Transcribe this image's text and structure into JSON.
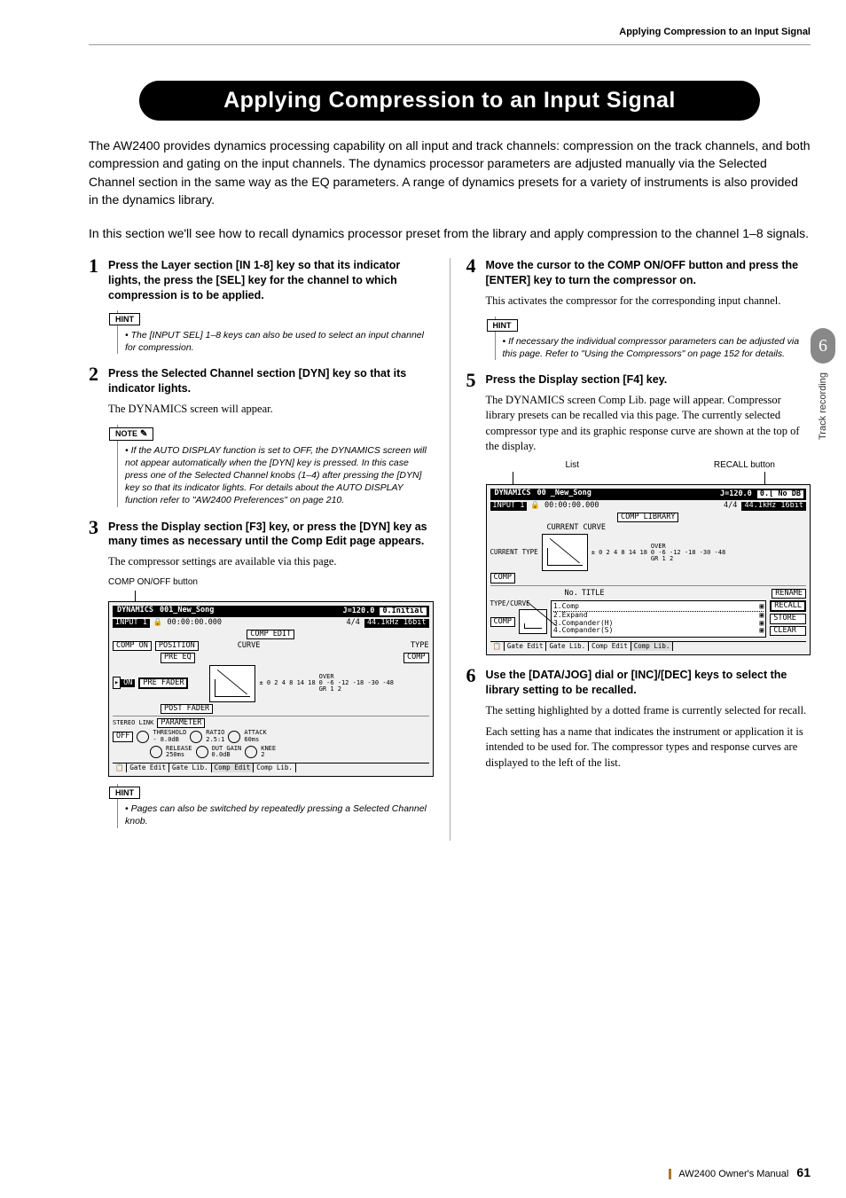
{
  "header": {
    "breadcrumb": "Applying Compression to an Input Signal"
  },
  "chapter": {
    "number": "6",
    "label": "Track recording"
  },
  "title": "Applying Compression to an Input Signal",
  "intro_p1": "The AW2400 provides dynamics processing capability on all input and track channels: compression on the track channels, and both compression and gating on the input channels. The dynamics processor parameters are adjusted manually via the Selected Channel section in the same way as the EQ parameters. A range of dynamics presets for a variety of instruments is also provided in the dynamics library.",
  "intro_p2": "In this section we'll see how to recall dynamics processor preset from the library and apply compression to the channel 1–8 signals.",
  "steps": {
    "s1": {
      "num": "1",
      "head": "Press the Layer section [IN 1-8] key so that its indicator lights, the press the [SEL] key for the channel to which compression is to be applied.",
      "hint": "The [INPUT SEL] 1–8 keys can also be used to select an input channel for compression."
    },
    "s2": {
      "num": "2",
      "head": "Press the Selected Channel section [DYN] key so that its indicator lights.",
      "body": "The DYNAMICS screen will appear.",
      "note": "If the AUTO DISPLAY function is set to OFF, the DYNAMICS screen will not appear automatically when the [DYN] key is pressed. In this case press one of the Selected Channel knobs (1–4) after pressing the [DYN] key so that its indicator lights. For details about the AUTO DISPLAY function refer to \"AW2400 Preferences\" on page 210."
    },
    "s3": {
      "num": "3",
      "head": "Press the Display section [F3] key, or press the [DYN] key as many times as necessary until the Comp Edit page appears.",
      "body": "The compressor settings are available via this page.",
      "caption": "COMP ON/OFF button",
      "hint": "Pages can also be switched by repeatedly pressing a Selected Channel knob."
    },
    "s4": {
      "num": "4",
      "head": "Move the cursor to the COMP ON/OFF button and press the [ENTER] key to turn the compressor on.",
      "body": "This activates the compressor for the corresponding input channel.",
      "hint": "If necessary the individual compressor parameters can be adjusted via this page. Refer to \"Using the Compressors\" on page 152 for details."
    },
    "s5": {
      "num": "5",
      "head": "Press the Display section [F4] key.",
      "body": "The DYNAMICS screen Comp Lib. page will appear. Compressor library presets can be recalled via this page. The currently selected compressor type and its graphic response curve are shown at the top of the display.",
      "label_list": "List",
      "label_recall": "RECALL button"
    },
    "s6": {
      "num": "6",
      "head": "Use the [DATA/JOG] dial or [INC]/[DEC] keys to select the library setting to be recalled.",
      "body1": "The setting highlighted by a dotted frame is currently selected for recall.",
      "body2": "Each setting has a name that indicates the instrument or application it is intended to be used for. The compressor types and response curves are displayed to the left of the list."
    }
  },
  "labels": {
    "hint": "HINT",
    "note": "NOTE"
  },
  "lcd1": {
    "title": "DYNAMICS",
    "sub": "INPUT 1",
    "song": "001_New_Song",
    "date": "00:00:00.000",
    "tempo": "J=120.0",
    "sig": "4/4",
    "preset": "0.Initial",
    "fmt": "44.1kHz 16bit",
    "section": "COMP EDIT",
    "comp_on": "COMP ON",
    "position": "POSITION",
    "pre_eq": "PRE EQ",
    "on": "ON",
    "pre_fader": "PRE FADER",
    "post_fader": "POST FADER",
    "curve": "CURVE",
    "type": "TYPE",
    "comp": "COMP",
    "stereo": "STEREO LINK",
    "off": "OFF",
    "parameter": "PARAMETER",
    "threshold": "THRESHOLD",
    "threshold_v": "- 8.0dB",
    "ratio": "RATIO",
    "ratio_v": "2.5:1",
    "attack": "ATTACK",
    "attack_v": "60ms",
    "release": "RELEASE",
    "release_v": "250ms",
    "outgain": "OUT GAIN",
    "outgain_v": "0.0dB",
    "knee": "KNEE",
    "knee_v": "2",
    "tabs": [
      "Gate Edit",
      "Gate Lib.",
      "Comp Edit",
      "Comp Lib."
    ],
    "meter_vals": "0 -6 -12 -18 -30 -48",
    "gr_vals": "0 2 4 8 14 18",
    "over": "OVER",
    "gr": "GR 1 2"
  },
  "lcd2": {
    "title": "DYNAMICS",
    "sub": "INPUT 1",
    "song": "00 _New_Song",
    "date": "00:00:00.000",
    "tempo": "J=120.0",
    "sig": "4/4",
    "nodb": "No DB",
    "fmt": "44.1kHz 16bit",
    "section": "COMP LIBRARY",
    "current_curve": "CURRENT CURVE",
    "current_type": "CURRENT TYPE",
    "comp": "COMP",
    "no": "No.",
    "title_h": "TITLE",
    "type_curve": "TYPE/CURVE",
    "list": [
      "1.Comp",
      "2.Expand",
      "3.Compander(H)",
      "4.Compander(S)"
    ],
    "rename": "RENAME",
    "recall": "RECALL",
    "store": "STORE",
    "clear": "CLEAR",
    "tabs": [
      "Gate Edit",
      "Gate Lib.",
      "Comp Edit",
      "Comp Lib."
    ]
  },
  "footer": {
    "manual": "AW2400  Owner's Manual",
    "page": "61"
  }
}
